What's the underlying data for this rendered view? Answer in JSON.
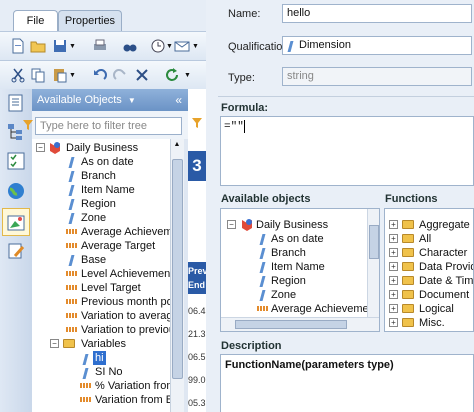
{
  "tabs": [
    {
      "label": "File"
    },
    {
      "label": "Properties"
    }
  ],
  "panel": {
    "title": "Available Objects",
    "filter_placeholder": "Type here to filter tree"
  },
  "tree": [
    {
      "label": "Daily Business",
      "kind": "universe"
    },
    {
      "label": "As on date",
      "kind": "dim"
    },
    {
      "label": "Branch",
      "kind": "dim"
    },
    {
      "label": "Item Name",
      "kind": "dim"
    },
    {
      "label": "Region",
      "kind": "dim"
    },
    {
      "label": "Zone",
      "kind": "dim"
    },
    {
      "label": "Average Achievement",
      "kind": "meas"
    },
    {
      "label": "Average Target",
      "kind": "meas"
    },
    {
      "label": "Base",
      "kind": "dim"
    },
    {
      "label": "Level Achievement",
      "kind": "meas"
    },
    {
      "label": "Level Target",
      "kind": "meas"
    },
    {
      "label": "Previous month positio",
      "kind": "meas"
    },
    {
      "label": "Variation to average ta",
      "kind": "meas"
    },
    {
      "label": "Variation to previous",
      "kind": "meas"
    },
    {
      "label": "Variables",
      "kind": "folder"
    },
    {
      "label": "hi",
      "kind": "dim"
    },
    {
      "label": "SI No",
      "kind": "dim"
    },
    {
      "label": "% Variation from B",
      "kind": "meas"
    },
    {
      "label": "Variation from B",
      "kind": "meas"
    }
  ],
  "middle": {
    "number": "3",
    "col_header_1": "Prev",
    "col_header_2": "End",
    "values": [
      "06.4",
      "21.3",
      "06.5",
      "99.0",
      "05.3"
    ]
  },
  "editor": {
    "name_label": "Name:",
    "name_value": "hello",
    "qual_label": "Qualification:",
    "qual_value": "Dimension",
    "type_label": "Type:",
    "type_value": "string",
    "formula_label": "Formula:",
    "formula_value": "=\"\"",
    "avail_label": "Available objects",
    "functions_label": "Functions",
    "avail_items": [
      "Daily Business",
      "As on date",
      "Branch",
      "Item Name",
      "Region",
      "Zone",
      "Average Achievement"
    ],
    "functions": [
      "Aggregate",
      "All",
      "Character",
      "Data Provide",
      "Date & Time",
      "Document",
      "Logical",
      "Misc."
    ],
    "desc_label": "Description",
    "desc_text": "FunctionName(parameters type)"
  }
}
